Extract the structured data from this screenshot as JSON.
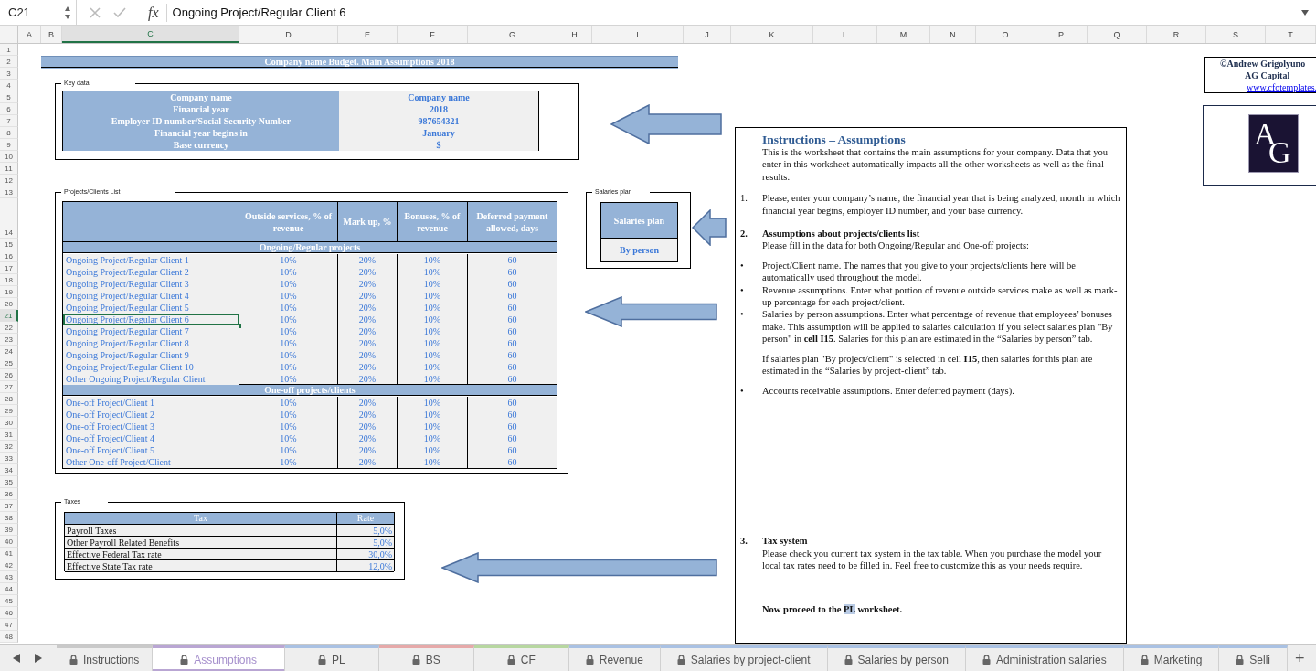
{
  "formula_bar": {
    "cell_ref": "C21",
    "function_label": "fx",
    "formula": "Ongoing Project/Regular Client 6"
  },
  "columns": [
    {
      "label": "A",
      "selected": false
    },
    {
      "label": "B",
      "selected": false
    },
    {
      "label": "C",
      "selected": true
    },
    {
      "label": "D",
      "selected": false
    },
    {
      "label": "E",
      "selected": false
    },
    {
      "label": "F",
      "selected": false
    },
    {
      "label": "G",
      "selected": false
    },
    {
      "label": "H",
      "selected": false
    },
    {
      "label": "I",
      "selected": false
    },
    {
      "label": "J",
      "selected": false
    },
    {
      "label": "K",
      "selected": false
    },
    {
      "label": "L",
      "selected": false
    },
    {
      "label": "M",
      "selected": false
    },
    {
      "label": "N",
      "selected": false
    },
    {
      "label": "O",
      "selected": false
    },
    {
      "label": "P",
      "selected": false
    },
    {
      "label": "Q",
      "selected": false
    },
    {
      "label": "R",
      "selected": false
    },
    {
      "label": "S",
      "selected": false
    },
    {
      "label": "T",
      "selected": false
    }
  ],
  "rows": [
    {
      "label": "1",
      "selected": false
    },
    {
      "label": "2",
      "selected": false
    },
    {
      "label": "3",
      "selected": false
    },
    {
      "label": "4",
      "selected": false
    },
    {
      "label": "5",
      "selected": false
    },
    {
      "label": "6",
      "selected": false
    },
    {
      "label": "7",
      "selected": false
    },
    {
      "label": "8",
      "selected": false
    },
    {
      "label": "9",
      "selected": false
    },
    {
      "label": "10",
      "selected": false
    },
    {
      "label": "11",
      "selected": false
    },
    {
      "label": "12",
      "selected": false
    },
    {
      "label": "13",
      "selected": false
    },
    {
      "label": "14",
      "selected": false
    },
    {
      "label": "15",
      "selected": false
    },
    {
      "label": "16",
      "selected": false
    },
    {
      "label": "17",
      "selected": false
    },
    {
      "label": "18",
      "selected": false
    },
    {
      "label": "19",
      "selected": false
    },
    {
      "label": "20",
      "selected": false
    },
    {
      "label": "21",
      "selected": true
    },
    {
      "label": "22",
      "selected": false
    },
    {
      "label": "23",
      "selected": false
    },
    {
      "label": "24",
      "selected": false
    },
    {
      "label": "25",
      "selected": false
    },
    {
      "label": "26",
      "selected": false
    },
    {
      "label": "27",
      "selected": false
    },
    {
      "label": "28",
      "selected": false
    },
    {
      "label": "29",
      "selected": false
    },
    {
      "label": "30",
      "selected": false
    },
    {
      "label": "31",
      "selected": false
    },
    {
      "label": "32",
      "selected": false
    },
    {
      "label": "33",
      "selected": false
    },
    {
      "label": "34",
      "selected": false
    },
    {
      "label": "35",
      "selected": false
    },
    {
      "label": "36",
      "selected": false
    },
    {
      "label": "37",
      "selected": false
    },
    {
      "label": "38",
      "selected": false
    },
    {
      "label": "39",
      "selected": false
    },
    {
      "label": "40",
      "selected": false
    },
    {
      "label": "41",
      "selected": false
    },
    {
      "label": "42",
      "selected": false
    },
    {
      "label": "43",
      "selected": false
    },
    {
      "label": "44",
      "selected": false
    },
    {
      "label": "45",
      "selected": false
    },
    {
      "label": "46",
      "selected": false
    },
    {
      "label": "47",
      "selected": false
    },
    {
      "label": "48",
      "selected": false
    }
  ],
  "title": "Company name Budget. Main Assumptions 2018",
  "key_data": {
    "caption": "Key data",
    "rows": [
      {
        "label": "Company name",
        "value": "Company name"
      },
      {
        "label": "Financial year",
        "value": "2018"
      },
      {
        "label": "Employer ID number/Social Security Number",
        "value": "987654321"
      },
      {
        "label": "Financial year begins in",
        "value": "January"
      },
      {
        "label": "Base currency",
        "value": "$"
      }
    ]
  },
  "projects": {
    "caption": "Projects/Clients List",
    "columns": [
      "Outside services, %  of revenue",
      "Mark up, %",
      "Bonuses, % of revenue",
      "Deferred payment allowed, days"
    ],
    "groups": [
      {
        "title": "Ongoing/Regular projects",
        "rows": [
          {
            "name": "Ongoing Project/Regular Client 1",
            "values": [
              "10%",
              "20%",
              "10%",
              "60"
            ],
            "selected": false
          },
          {
            "name": "Ongoing Project/Regular Client 2",
            "values": [
              "10%",
              "20%",
              "10%",
              "60"
            ],
            "selected": false
          },
          {
            "name": "Ongoing Project/Regular Client 3",
            "values": [
              "10%",
              "20%",
              "10%",
              "60"
            ],
            "selected": false
          },
          {
            "name": "Ongoing Project/Regular Client 4",
            "values": [
              "10%",
              "20%",
              "10%",
              "60"
            ],
            "selected": false
          },
          {
            "name": "Ongoing Project/Regular Client 5",
            "values": [
              "10%",
              "20%",
              "10%",
              "60"
            ],
            "selected": false
          },
          {
            "name": "Ongoing Project/Regular Client 6",
            "values": [
              "10%",
              "20%",
              "10%",
              "60"
            ],
            "selected": true
          },
          {
            "name": "Ongoing Project/Regular Client 7",
            "values": [
              "10%",
              "20%",
              "10%",
              "60"
            ],
            "selected": false
          },
          {
            "name": "Ongoing Project/Regular Client 8",
            "values": [
              "10%",
              "20%",
              "10%",
              "60"
            ],
            "selected": false
          },
          {
            "name": "Ongoing Project/Regular Client 9",
            "values": [
              "10%",
              "20%",
              "10%",
              "60"
            ],
            "selected": false
          },
          {
            "name": "Ongoing Project/Regular Client 10",
            "values": [
              "10%",
              "20%",
              "10%",
              "60"
            ],
            "selected": false
          },
          {
            "name": "Other Ongoing Project/Regular Client",
            "values": [
              "10%",
              "20%",
              "10%",
              "60"
            ],
            "selected": false
          }
        ]
      },
      {
        "title": "One-off projects/clients",
        "rows": [
          {
            "name": "One-off Project/Client 1",
            "values": [
              "10%",
              "20%",
              "10%",
              "60"
            ],
            "selected": false
          },
          {
            "name": "One-off Project/Client 2",
            "values": [
              "10%",
              "20%",
              "10%",
              "60"
            ],
            "selected": false
          },
          {
            "name": "One-off Project/Client 3",
            "values": [
              "10%",
              "20%",
              "10%",
              "60"
            ],
            "selected": false
          },
          {
            "name": "One-off Project/Client 4",
            "values": [
              "10%",
              "20%",
              "10%",
              "60"
            ],
            "selected": false
          },
          {
            "name": "One-off Project/Client 5",
            "values": [
              "10%",
              "20%",
              "10%",
              "60"
            ],
            "selected": false
          },
          {
            "name": "Other One-off Project/Client",
            "values": [
              "10%",
              "20%",
              "10%",
              "60"
            ],
            "selected": false
          }
        ]
      }
    ]
  },
  "salaries_plan": {
    "caption": "Salaries plan",
    "header": "Salaries plan",
    "value": "By person"
  },
  "taxes": {
    "caption": "Taxes",
    "columns": [
      "Tax",
      "Rate"
    ],
    "rows": [
      {
        "name": "Payroll Taxes",
        "rate": "5,0%"
      },
      {
        "name": "Other Payroll Related Benefits",
        "rate": "5,0%"
      },
      {
        "name": "Effective Federal Tax rate",
        "rate": "30,0%"
      },
      {
        "name": "Effective State Tax rate",
        "rate": "12,0%"
      }
    ]
  },
  "instructions": {
    "body": [
      {
        "kind": "title",
        "text": "Instructions – Assumptions"
      },
      {
        "kind": "para",
        "text": "This is the worksheet that contains the main assumptions for your company. Data that you enter in this worksheet automatically impacts all the other worksheets as well as the final results."
      },
      {
        "kind": "numbered",
        "marker": "1.",
        "text": "Please, enter your company’s name, the financial year that is being analyzed, month in which financial year begins, employer ID number, and your base currency."
      },
      {
        "kind": "heading",
        "marker": "2.",
        "text": "Assumptions about projects/clients list"
      },
      {
        "kind": "para",
        "text": "Please fill in the data for both Ongoing/Regular and One-off projects:"
      },
      {
        "kind": "bullet",
        "marker": "•",
        "text": "Project/Client name. The names that you give to your projects/clients here will be automatically used throughout the model."
      },
      {
        "kind": "bullet",
        "marker": "•",
        "text": "Revenue assumptions. Enter what portion of revenue outside services make as well as mark-up percentage for each project/client."
      },
      {
        "kind": "bullet",
        "marker": "•",
        "text": "Salaries by person assumptions. Enter what percentage of revenue that employees’ bonuses make. This assumption will be applied to salaries calculation if you select salaries plan \"By person\" in **cell I15**. Salaries for this plan are estimated in the “Salaries by person” tab."
      },
      {
        "kind": "para",
        "text": "If salaries plan \"By project/client\" is selected in cell **I15**, then salaries for this plan are estimated in the “Salaries by project-client” tab."
      },
      {
        "kind": "bullet",
        "marker": "•",
        "text": "Accounts receivable assumptions. Enter deferred payment (days)."
      }
    ],
    "footer": [
      {
        "kind": "heading",
        "marker": "3.",
        "text": "Tax system"
      },
      {
        "kind": "para",
        "text": "Please check you current tax system in the tax table. When you purchase the model your local tax rates need to be filled in. Feel free to customize this as your needs require."
      },
      {
        "kind": "closing",
        "text": "Now proceed to the ",
        "highlight": "PL",
        "after": " worksheet."
      }
    ]
  },
  "copyright": {
    "author": "©Andrew Grigolyuno",
    "company": "AG Capital",
    "link": "www.cfotemplates."
  },
  "logo": {
    "letters": [
      "A",
      "G"
    ]
  },
  "tabs": [
    {
      "label": "Instructions",
      "selected": false,
      "locked": true,
      "color": "#c9c9c9"
    },
    {
      "label": "Assumptions",
      "selected": true,
      "locked": true,
      "color": "#b9a6d3"
    },
    {
      "label": "PL",
      "selected": false,
      "locked": true,
      "color": "#a9c1e3"
    },
    {
      "label": "BS",
      "selected": false,
      "locked": true,
      "color": "#e6a9a9"
    },
    {
      "label": "CF",
      "selected": false,
      "locked": true,
      "color": "#b7d7a0"
    },
    {
      "label": "Revenue",
      "selected": false,
      "locked": true,
      "color": "#a9c1e3"
    },
    {
      "label": "Salaries by project-client",
      "selected": false,
      "locked": true,
      "color": "#a9c1e3"
    },
    {
      "label": "Salaries by person",
      "selected": false,
      "locked": true,
      "color": "#a9c1e3"
    },
    {
      "label": "Administration salaries",
      "selected": false,
      "locked": true,
      "color": "#a9c1e3"
    },
    {
      "label": "Marketing",
      "selected": false,
      "locked": true,
      "color": "#a9c1e3"
    },
    {
      "label": "Selli",
      "selected": false,
      "locked": true,
      "color": "#a9c1e3"
    }
  ],
  "add_sheet": "+"
}
